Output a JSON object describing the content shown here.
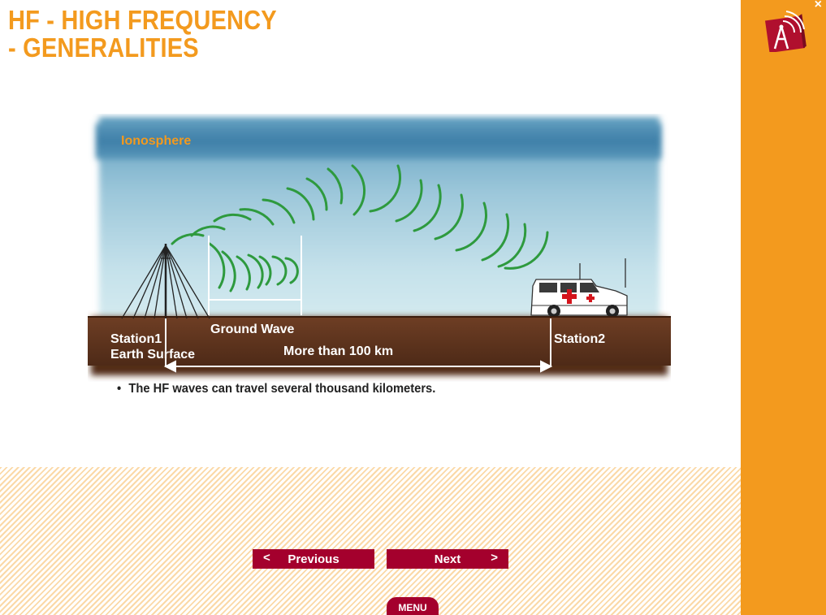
{
  "title": {
    "line1": "HF - HIGH FREQUENCY",
    "line2": "- GENERALITIES"
  },
  "diagram": {
    "ionosphere_label": "Ionosphere",
    "station1_label": "Station1",
    "earth_surface_label": "Earth Surface",
    "ground_wave_label": "Ground Wave",
    "distance_label": "More than 100 km",
    "station2_label": "Station2"
  },
  "bullet_text": "The HF waves can travel several thousand kilometers.",
  "nav": {
    "prev_arrow": "<",
    "prev_label": "Previous",
    "next_label": "Next",
    "next_arrow": ">",
    "menu_label": "MENU",
    "close_glyph": "×"
  },
  "colors": {
    "title_orange": "#F39A1E",
    "button_red": "#A4002D",
    "wave_green": "#2E9A3E",
    "ground_brown": "#6B3A22"
  },
  "icons": [
    "antenna-logo-icon",
    "close-icon",
    "antenna-mast-icon",
    "ambulance-icon"
  ]
}
